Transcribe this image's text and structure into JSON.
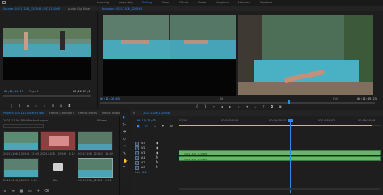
{
  "app": {
    "workspaces": [
      "Learning",
      "Assembly",
      "Editing",
      "Color",
      "Effects",
      "Audio",
      "Graphics",
      "Libraries",
      "Captions"
    ],
    "active_workspace": "Editing"
  },
  "source_monitor": {
    "tab_label": "Source: 20211106_120948 (20211106MainSelection)",
    "secondary_tabs": [
      "Audio Clip Mixer",
      "Metadata"
    ],
    "timecode_in": "00;21;14;19",
    "page_label": "Page 1",
    "timecode_out": "00;12;23;2"
  },
  "program_monitor": {
    "tab_label": "Program: 20211106_120948",
    "timecode_in": "00;11;26;03",
    "fit_label": "Fit",
    "quality_label": "Full",
    "timecode_out": "00;11;49;23"
  },
  "project_panel": {
    "tabs": [
      "Project: 2021-11-06 R3H Workout",
      "Effects (Footage Clip)",
      "Effects Browser",
      "Media Browser"
    ],
    "project_file": "2021-11-06 R3H Workout.prproj",
    "items_count": "8 Items",
    "thumbnails": [
      {
        "name": "20211106_120948.mp4",
        "duration": "12:05"
      },
      {
        "name": "20211106_120949.mp4",
        "duration": "4:12"
      },
      {
        "name": "20211106_121108.mp4",
        "duration": "14:02"
      },
      {
        "name": "20211106_121355.mp4",
        "duration": "6:40"
      },
      {
        "name": "Bin",
        "duration": ""
      },
      {
        "name": "20211106_121521.mp4",
        "duration": "9:31"
      }
    ]
  },
  "timeline": {
    "tabs": [
      "x",
      "20211106_120948"
    ],
    "timecode": "00;11;26;03",
    "ruler_labels": [
      "00;00",
      "00;04;59;16",
      "00;09;59;10",
      "00;14;59;02",
      "00;19;58;29"
    ],
    "tracks": [
      "V3",
      "V2",
      "V1",
      "A1",
      "A2",
      "A3",
      "Mix"
    ],
    "clip_labels": [
      "20211106_120948",
      "20211106_120948"
    ],
    "mix_value": "0.0"
  },
  "colors": {
    "accent": "#2d8ceb",
    "clip_video": "#69b56b",
    "playhead": "#2d8ceb",
    "in_out": "#c9c92a"
  }
}
